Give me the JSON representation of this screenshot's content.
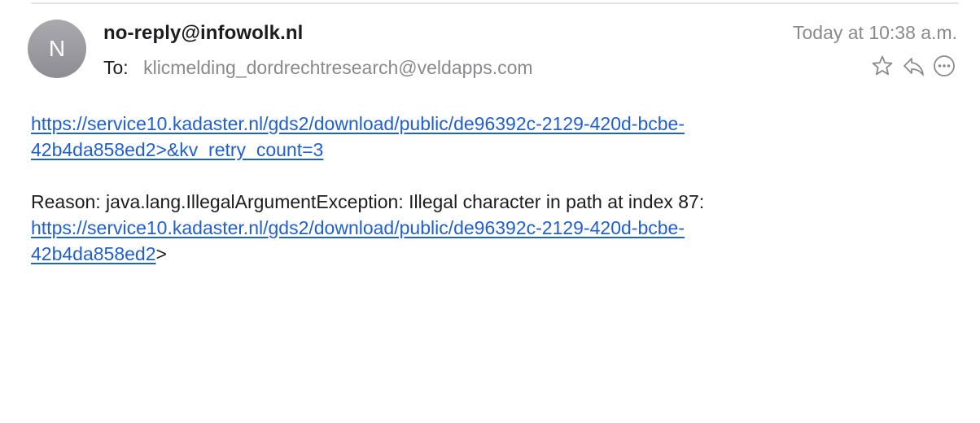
{
  "message": {
    "avatar_initial": "N",
    "sender": "no-reply@infowolk.nl",
    "to_label": "To:",
    "to_address": "klicmelding_dordrechtresearch@veldapps.com",
    "timestamp": "Today at 10:38 a.m."
  },
  "actions": {
    "icons": [
      "star-icon",
      "reply-icon",
      "more-icon"
    ],
    "color": "#8a8a8e"
  },
  "body": {
    "link1_line1": "https://service10.kadaster.nl/gds2/download/public/de96392c-2129-420d-bcbe-",
    "link1_line2": "42b4da858ed2>&kv_retry_count=3",
    "reason_text": "Reason: java.lang.IllegalArgumentException: Illegal character in path at index 87:",
    "link2_line1": "https://service10.kadaster.nl/gds2/download/public/de96392c-2129-420d-bcbe-",
    "link2_line2": "42b4da858ed2",
    "link2_suffix": ">"
  },
  "colors": {
    "link": "#1f5fd0",
    "muted": "#8a8a8e",
    "avatar": "#9b9ba0"
  }
}
